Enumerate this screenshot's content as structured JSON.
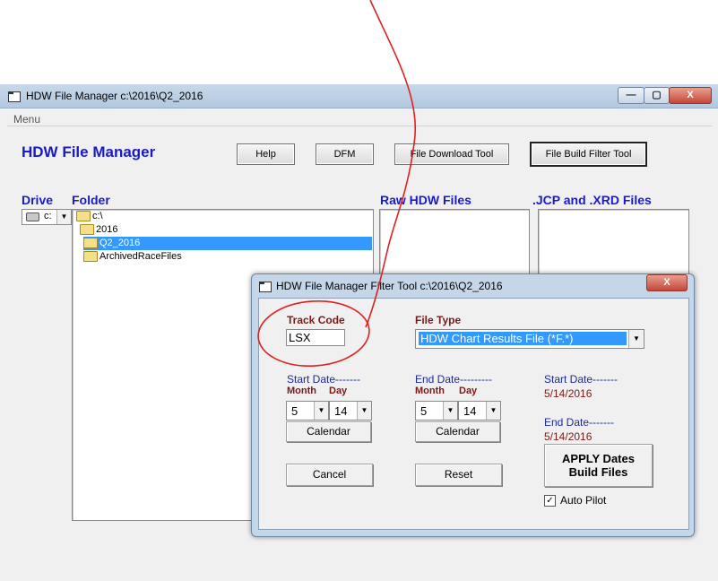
{
  "main_window": {
    "title": "HDW File Manager c:\\2016\\Q2_2016",
    "minimize": "—",
    "maximize": "▢",
    "close": "X",
    "menu": "Menu",
    "heading": "HDW File Manager",
    "buttons": {
      "help": "Help",
      "dfm": "DFM",
      "file_download": "File Download Tool",
      "file_build_filter": "File Build Filter Tool"
    },
    "drive_label": "Drive",
    "folder_label": "Folder",
    "raw_files_label": "Raw HDW Files",
    "jcp_files_label": ".JCP and .XRD Files",
    "drive_value": "c:",
    "folders": [
      {
        "label": "c:\\",
        "selected": false
      },
      {
        "label": "2016",
        "selected": false
      },
      {
        "label": "Q2_2016",
        "selected": true
      },
      {
        "label": "ArchivedRaceFiles",
        "selected": false
      }
    ]
  },
  "dialog": {
    "title": "HDW File Manager Filter Tool c:\\2016\\Q2_2016",
    "close": "X",
    "track_code_label": "Track Code",
    "track_code_value": "LSX",
    "file_type_label": "File Type",
    "file_type_value": "HDW Chart Results File (*F.*)",
    "start_date_label": "Start Date-------",
    "end_date_label": "End Date---------",
    "month_label": "Month",
    "day_label": "Day",
    "start_month": "5",
    "start_day": "14",
    "end_month": "5",
    "end_day": "14",
    "calendar_button": "Calendar",
    "cancel_button": "Cancel",
    "reset_button": "Reset",
    "summary_start_label": "Start Date-------",
    "summary_start_value": "5/14/2016",
    "summary_end_label": "End Date-------",
    "summary_end_value": "5/14/2016",
    "apply_line1": "APPLY Dates",
    "apply_line2": "Build Files",
    "auto_pilot_label": "Auto Pilot",
    "auto_pilot_checked": true
  },
  "annotation_color": "#e02020"
}
